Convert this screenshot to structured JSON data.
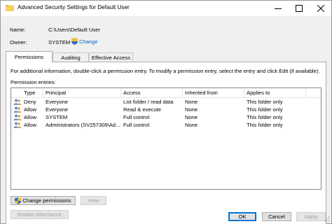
{
  "window": {
    "title": "Advanced Security Settings for Default User",
    "minimize_icon": "minimize-icon",
    "maximize_icon": "maximize-icon",
    "close_icon": "close-icon"
  },
  "info": {
    "name_label": "Name:",
    "name_value": "C:\\Users\\Default User",
    "owner_label": "Owner:",
    "owner_value": "SYSTEM",
    "change_link": "Change"
  },
  "tabs": [
    {
      "label": "Permissions",
      "active": true
    },
    {
      "label": "Auditing",
      "active": false
    },
    {
      "label": "Effective Access",
      "active": false
    }
  ],
  "permissions": {
    "info_text": "For additional information, double-click a permission entry. To modify a permission entry, select the entry and click Edit (if available).",
    "entries_label": "Permission entries:",
    "columns": [
      "Type",
      "Principal",
      "Access",
      "Inherited from",
      "Applies to"
    ],
    "rows": [
      {
        "type": "Deny",
        "principal": "Everyone",
        "access": "List folder / read data",
        "inherited": "None",
        "applies": "This folder only"
      },
      {
        "type": "Allow",
        "principal": "Everyone",
        "access": "Read & execute",
        "inherited": "None",
        "applies": "This folder only"
      },
      {
        "type": "Allow",
        "principal": "SYSTEM",
        "access": "Full control",
        "inherited": "None",
        "applies": "This folder only"
      },
      {
        "type": "Allow",
        "principal": "Administrators (SV257309\\Ad...",
        "access": "Full control",
        "inherited": "None",
        "applies": "This folder only"
      }
    ],
    "change_permissions_button": "Change permissions",
    "view_button": "View",
    "enable_inheritance_button": "Enable inheritance"
  },
  "footer": {
    "ok": "OK",
    "cancel": "Cancel",
    "apply": "Apply"
  },
  "colors": {
    "link": "#0066cc",
    "accent": "#0078d7"
  }
}
